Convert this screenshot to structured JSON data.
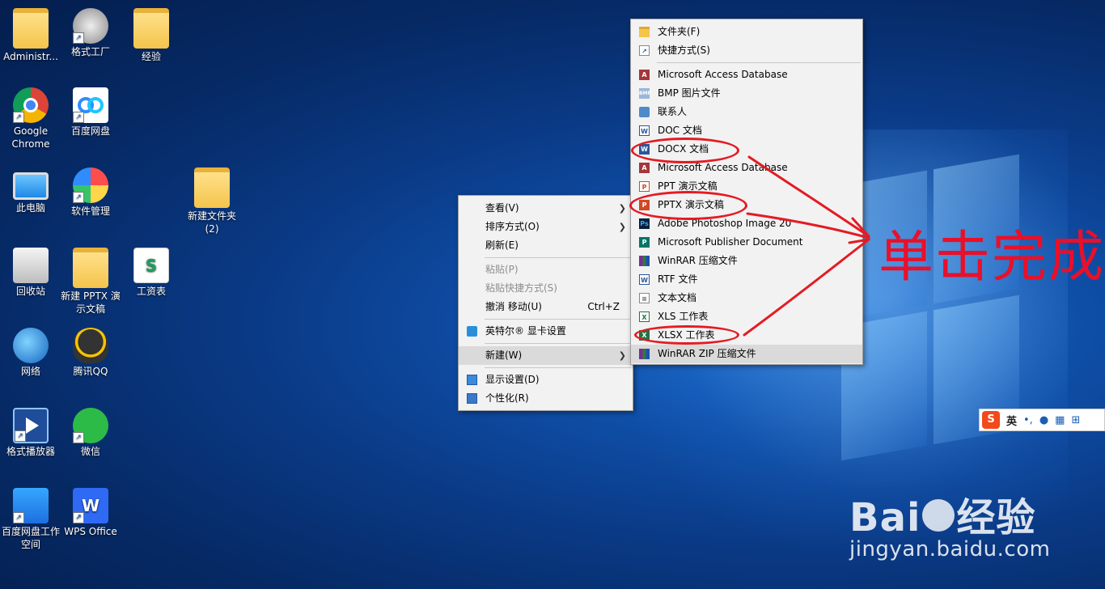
{
  "desktop_icons": [
    {
      "label": "Administr...",
      "kind": "user-folder"
    },
    {
      "label": "格式工厂",
      "kind": "format-factory"
    },
    {
      "label": "经验",
      "kind": "folder"
    },
    {
      "label": "Google Chrome",
      "kind": "chrome"
    },
    {
      "label": "百度网盘",
      "kind": "baidu-netdisk"
    },
    {
      "label": "此电脑",
      "kind": "this-pc"
    },
    {
      "label": "软件管理",
      "kind": "software-manager"
    },
    {
      "label": "新建文件夹 (2)",
      "kind": "folder"
    },
    {
      "label": "回收站",
      "kind": "recycle-bin"
    },
    {
      "label": "新建 PPTX 演示文稿",
      "kind": "pptx-file"
    },
    {
      "label": "工资表",
      "kind": "xls-file"
    },
    {
      "label": "网络",
      "kind": "network"
    },
    {
      "label": "腾讯QQ",
      "kind": "qq"
    },
    {
      "label": "格式播放器",
      "kind": "format-player"
    },
    {
      "label": "微信",
      "kind": "wechat"
    },
    {
      "label": "百度网盘工作空间",
      "kind": "baidu-workspace"
    },
    {
      "label": "WPS Office",
      "kind": "wps"
    }
  ],
  "main_menu": {
    "view": {
      "label": "查看(V)"
    },
    "sort": {
      "label": "排序方式(O)"
    },
    "refresh": {
      "label": "刷新(E)"
    },
    "paste": {
      "label": "粘贴(P)"
    },
    "paste_shortcut": {
      "label": "粘贴快捷方式(S)"
    },
    "undo": {
      "label": "撤消 移动(U)",
      "accel": "Ctrl+Z"
    },
    "intel": {
      "label": "英特尔® 显卡设置"
    },
    "new": {
      "label": "新建(W)"
    },
    "display": {
      "label": "显示设置(D)"
    },
    "personalize": {
      "label": "个性化(R)"
    }
  },
  "new_menu": {
    "items": [
      {
        "label": "文件夹(F)",
        "icon": "folder-icon"
      },
      {
        "label": "快捷方式(S)",
        "icon": "shortcut-icon"
      },
      {
        "label": "Microsoft Access Database",
        "icon": "access-icon"
      },
      {
        "label": "BMP 图片文件",
        "icon": "bmp-icon"
      },
      {
        "label": "联系人",
        "icon": "contact-icon"
      },
      {
        "label": "DOC 文档",
        "icon": "doc-icon"
      },
      {
        "label": "DOCX 文档",
        "icon": "docx-icon"
      },
      {
        "label": "Microsoft Access Database",
        "icon": "access-icon"
      },
      {
        "label": "PPT 演示文稿",
        "icon": "ppt-icon"
      },
      {
        "label": "PPTX 演示文稿",
        "icon": "pptx-icon"
      },
      {
        "label": "Adobe Photoshop Image 20",
        "icon": "photoshop-icon"
      },
      {
        "label": "Microsoft Publisher Document",
        "icon": "publisher-icon"
      },
      {
        "label": "WinRAR 压缩文件",
        "icon": "winrar-icon"
      },
      {
        "label": "RTF 文件",
        "icon": "rtf-icon"
      },
      {
        "label": "文本文档",
        "icon": "text-icon"
      },
      {
        "label": "XLS 工作表",
        "icon": "xls-icon"
      },
      {
        "label": "XLSX 工作表",
        "icon": "xlsx-icon"
      },
      {
        "label": "WinRAR ZIP 压缩文件",
        "icon": "winrar-zip-icon"
      }
    ]
  },
  "annotation": {
    "text": "单击完成",
    "color": "#e41b23"
  },
  "ime": {
    "mode": "英",
    "punct": "•,"
  },
  "watermark": {
    "brand_left": "Bai",
    "brand_right": "经验",
    "site": "jingyan.baidu.com"
  }
}
